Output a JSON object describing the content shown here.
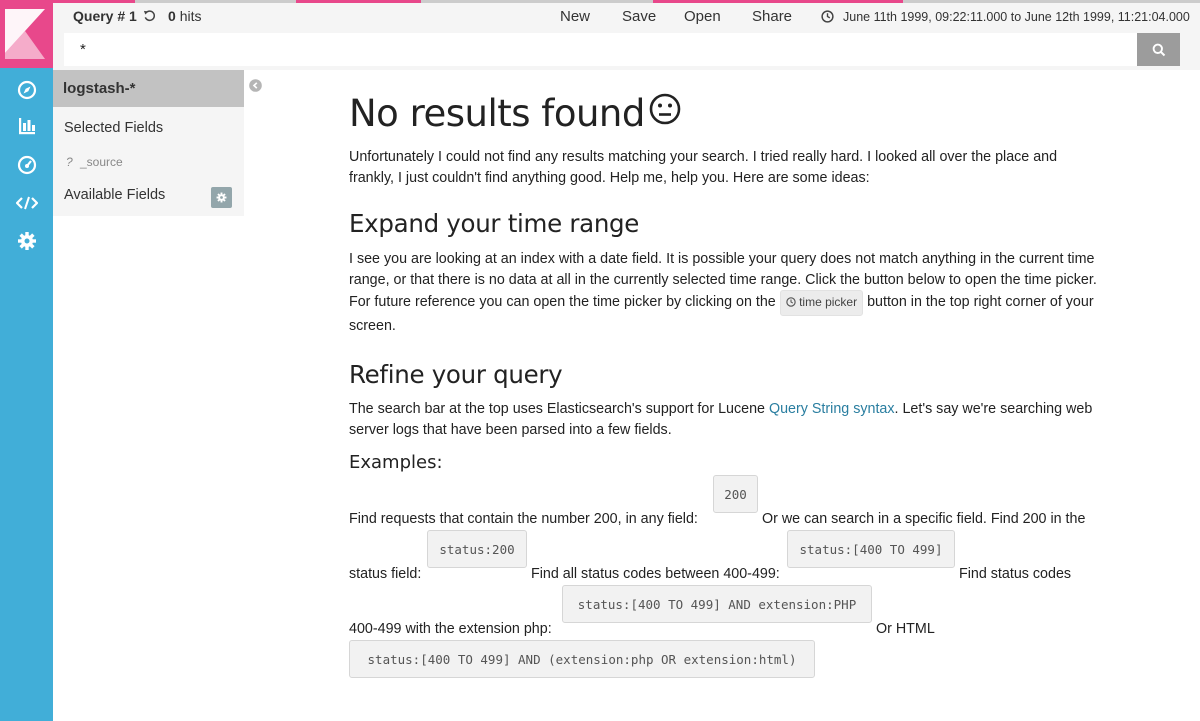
{
  "colors": {
    "nav_blue": "#41aed8",
    "logo_pink": "#e8488b",
    "link_blue": "#2a7ea0",
    "search_button": "#9c9c9c"
  },
  "app": {
    "logo": "kibana-logo",
    "nav_icons": [
      "compass-icon",
      "bar-chart-icon",
      "gauge-icon",
      "code-icon",
      "gear-icon"
    ]
  },
  "topbar": {
    "query_title": "Query # 1",
    "hits_count": "0",
    "hits_label": "hits",
    "menu": [
      "New",
      "Save",
      "Open",
      "Share"
    ],
    "time_range": "June 11th 1999, 09:22:11.000 to June 12th 1999, 11:21:04.000"
  },
  "search": {
    "value": "*"
  },
  "sidebar": {
    "index_pattern": "logstash-*",
    "selected_fields": "Selected Fields",
    "source_type": "?",
    "source_field": "_source",
    "available_fields": "Available Fields"
  },
  "main": {
    "title": "No results found",
    "intro": "Unfortunately I could not find any results matching your search. I tried really hard. I looked all over the place and frankly, I just couldn't find anything good. Help me, help you. Here are some ideas:",
    "time_heading": "Expand your time range",
    "time_para_1": "I see you are looking at an index with a date field. It is possible your query does not match anything in the current time range, or that there is no data at all in the currently selected time range. Click the button below to open the time picker. For future reference you can open the time picker by clicking on the",
    "time_picker_chip": "time picker",
    "time_para_2": "button in the top right corner of your screen.",
    "refine_heading": "Refine your query",
    "refine_para_1": "The search bar at the top uses Elasticsearch's support for Lucene",
    "refine_link": "Query String syntax",
    "refine_para_2": ". Let's say we're searching web server logs that have been parsed into a few fields.",
    "examples_heading": "Examples:",
    "examples": {
      "t1": "Find requests that contain the number 200, in any field:",
      "c1": "200",
      "t2": "Or we can search in a specific field. Find 200 in the",
      "t3": "status field:",
      "c2": "status:200",
      "t4": "Find all status codes between 400-499:",
      "c3": "status:[400 TO 499]",
      "t5": "Find status codes",
      "t6": "400-499 with the extension php:",
      "c4": "status:[400 TO 499] AND extension:PHP",
      "t7": "Or HTML",
      "c5": "status:[400 TO 499] AND (extension:php OR extension:html)"
    }
  }
}
